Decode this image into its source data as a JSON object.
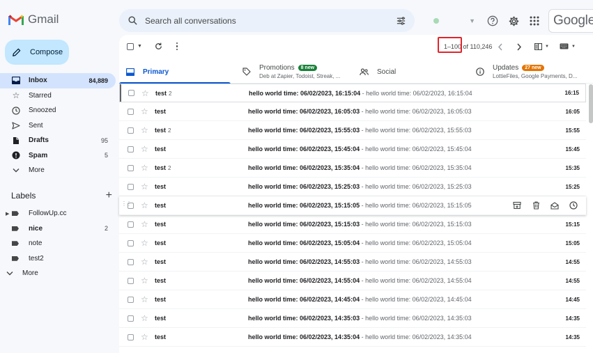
{
  "app": {
    "name": "Gmail"
  },
  "search": {
    "placeholder": "Search all conversations"
  },
  "brand": {
    "google": "Google"
  },
  "compose": {
    "label": "Compose"
  },
  "nav": [
    {
      "label": "Inbox",
      "count": "84,889",
      "icon": "inbox-icon"
    },
    {
      "label": "Starred",
      "count": "",
      "icon": "star-icon"
    },
    {
      "label": "Snoozed",
      "count": "",
      "icon": "clock-icon"
    },
    {
      "label": "Sent",
      "count": "",
      "icon": "send-icon"
    },
    {
      "label": "Drafts",
      "count": "95",
      "icon": "draft-icon"
    },
    {
      "label": "Spam",
      "count": "5",
      "icon": "spam-icon"
    },
    {
      "label": "More",
      "count": "",
      "icon": "chevron-down-icon"
    }
  ],
  "labels": {
    "title": "Labels",
    "items": [
      {
        "label": "FollowUp.cc",
        "count": ""
      },
      {
        "label": "nice",
        "count": "2"
      },
      {
        "label": "note",
        "count": ""
      },
      {
        "label": "test2",
        "count": ""
      }
    ],
    "more": "More"
  },
  "pager": {
    "range": "1–100",
    "of": "of 110,246"
  },
  "tabs": [
    {
      "label": "Primary",
      "sub": "",
      "badge": "",
      "badge_color": ""
    },
    {
      "label": "Promotions",
      "sub": "Deb at Zapier, Todoist, Streak, ...",
      "badge": "8 new",
      "badge_color": "#188038"
    },
    {
      "label": "Social",
      "sub": "",
      "badge": "",
      "badge_color": ""
    },
    {
      "label": "Updates",
      "sub": "LottieFiles, Google Payments, D...",
      "badge": "27 new",
      "badge_color": "#e37400"
    }
  ],
  "emails": [
    {
      "sender": "test",
      "num": "2",
      "subject": "hello world time: 06/02/2023, 16:15:04",
      "snippet": "hello world time: 06/02/2023, 16:15:04",
      "time": "16:15"
    },
    {
      "sender": "test",
      "num": "",
      "subject": "hello world time: 06/02/2023, 16:05:03",
      "snippet": "hello world time: 06/02/2023, 16:05:03",
      "time": "16:05"
    },
    {
      "sender": "test",
      "num": "2",
      "subject": "hello world time: 06/02/2023, 15:55:03",
      "snippet": "hello world time: 06/02/2023, 15:55:03",
      "time": "15:55"
    },
    {
      "sender": "test",
      "num": "",
      "subject": "hello world time: 06/02/2023, 15:45:04",
      "snippet": "hello world time: 06/02/2023, 15:45:04",
      "time": "15:45"
    },
    {
      "sender": "test",
      "num": "2",
      "subject": "hello world time: 06/02/2023, 15:35:04",
      "snippet": "hello world time: 06/02/2023, 15:35:04",
      "time": "15:35"
    },
    {
      "sender": "test",
      "num": "",
      "subject": "hello world time: 06/02/2023, 15:25:03",
      "snippet": "hello world time: 06/02/2023, 15:25:03",
      "time": "15:25"
    },
    {
      "sender": "test",
      "num": "",
      "subject": "hello world time: 06/02/2023, 15:15:05",
      "snippet": "hello world time: 06/02/2023, 15:15:05",
      "time": ""
    },
    {
      "sender": "test",
      "num": "",
      "subject": "hello world time: 06/02/2023, 15:15:03",
      "snippet": "hello world time: 06/02/2023, 15:15:03",
      "time": "15:15"
    },
    {
      "sender": "test",
      "num": "",
      "subject": "hello world time: 06/02/2023, 15:05:04",
      "snippet": "hello world time: 06/02/2023, 15:05:04",
      "time": "15:05"
    },
    {
      "sender": "test",
      "num": "",
      "subject": "hello world time: 06/02/2023, 14:55:03",
      "snippet": "hello world time: 06/02/2023, 14:55:03",
      "time": "14:55"
    },
    {
      "sender": "test",
      "num": "",
      "subject": "hello world time: 06/02/2023, 14:55:04",
      "snippet": "hello world time: 06/02/2023, 14:55:04",
      "time": "14:55"
    },
    {
      "sender": "test",
      "num": "",
      "subject": "hello world time: 06/02/2023, 14:45:04",
      "snippet": "hello world time: 06/02/2023, 14:45:04",
      "time": "14:45"
    },
    {
      "sender": "test",
      "num": "",
      "subject": "hello world time: 06/02/2023, 14:35:03",
      "snippet": "hello world time: 06/02/2023, 14:35:03",
      "time": "14:35"
    },
    {
      "sender": "test",
      "num": "",
      "subject": "hello world time: 06/02/2023, 14:35:04",
      "snippet": "hello world time: 06/02/2023, 14:35:04",
      "time": "14:35"
    }
  ],
  "colors": {
    "accent": "#0b57d0",
    "compose_bg": "#c2e7ff",
    "active_nav": "#d3e3fd",
    "highlight": "#e3232b"
  }
}
